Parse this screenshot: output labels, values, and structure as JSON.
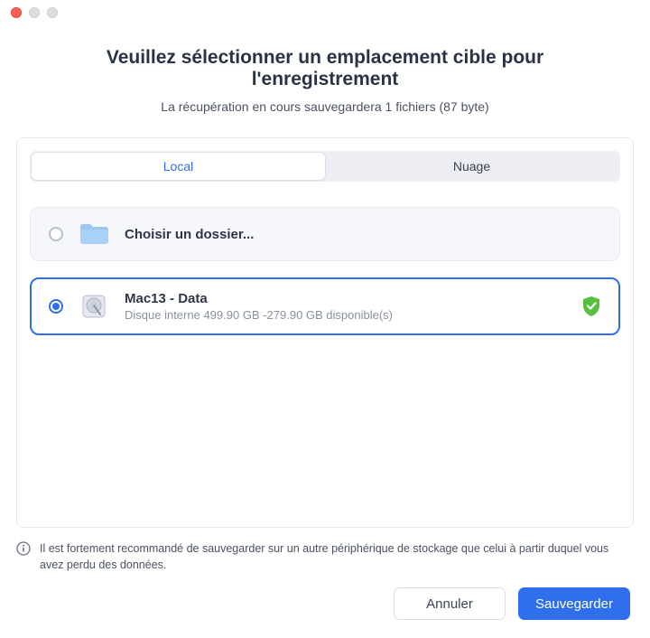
{
  "header": {
    "title": "Veuillez sélectionner un emplacement cible pour l'enregistrement",
    "subtitle": "La récupération en cours sauvegardera 1 fichiers (87 byte)"
  },
  "tabs": {
    "local": "Local",
    "cloud": "Nuage"
  },
  "options": {
    "choose_folder": {
      "title": "Choisir un dossier..."
    },
    "disk": {
      "title": "Mac13 - Data",
      "subtitle": "Disque interne 499.90 GB -279.90 GB disponible(s)"
    }
  },
  "info": {
    "text": "Il est fortement recommandé de sauvegarder sur un autre périphérique de stockage que celui à partir duquel vous avez perdu des données."
  },
  "buttons": {
    "cancel": "Annuler",
    "save": "Sauvegarder"
  }
}
